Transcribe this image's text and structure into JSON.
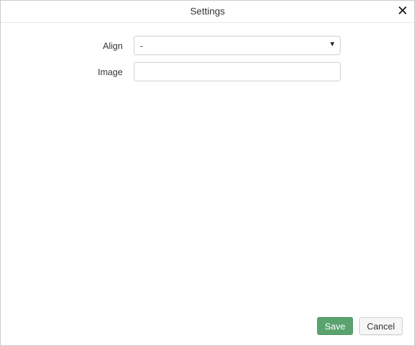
{
  "dialog": {
    "title": "Settings",
    "close_icon": "close-icon"
  },
  "form": {
    "align": {
      "label": "Align",
      "value": "-",
      "caret_icon": "caret-down-icon"
    },
    "image": {
      "label": "Image",
      "value": "",
      "placeholder": ""
    }
  },
  "footer": {
    "save_label": "Save",
    "cancel_label": "Cancel"
  },
  "colors": {
    "save_button": "#5aa36f",
    "border": "#c9c9c9"
  }
}
